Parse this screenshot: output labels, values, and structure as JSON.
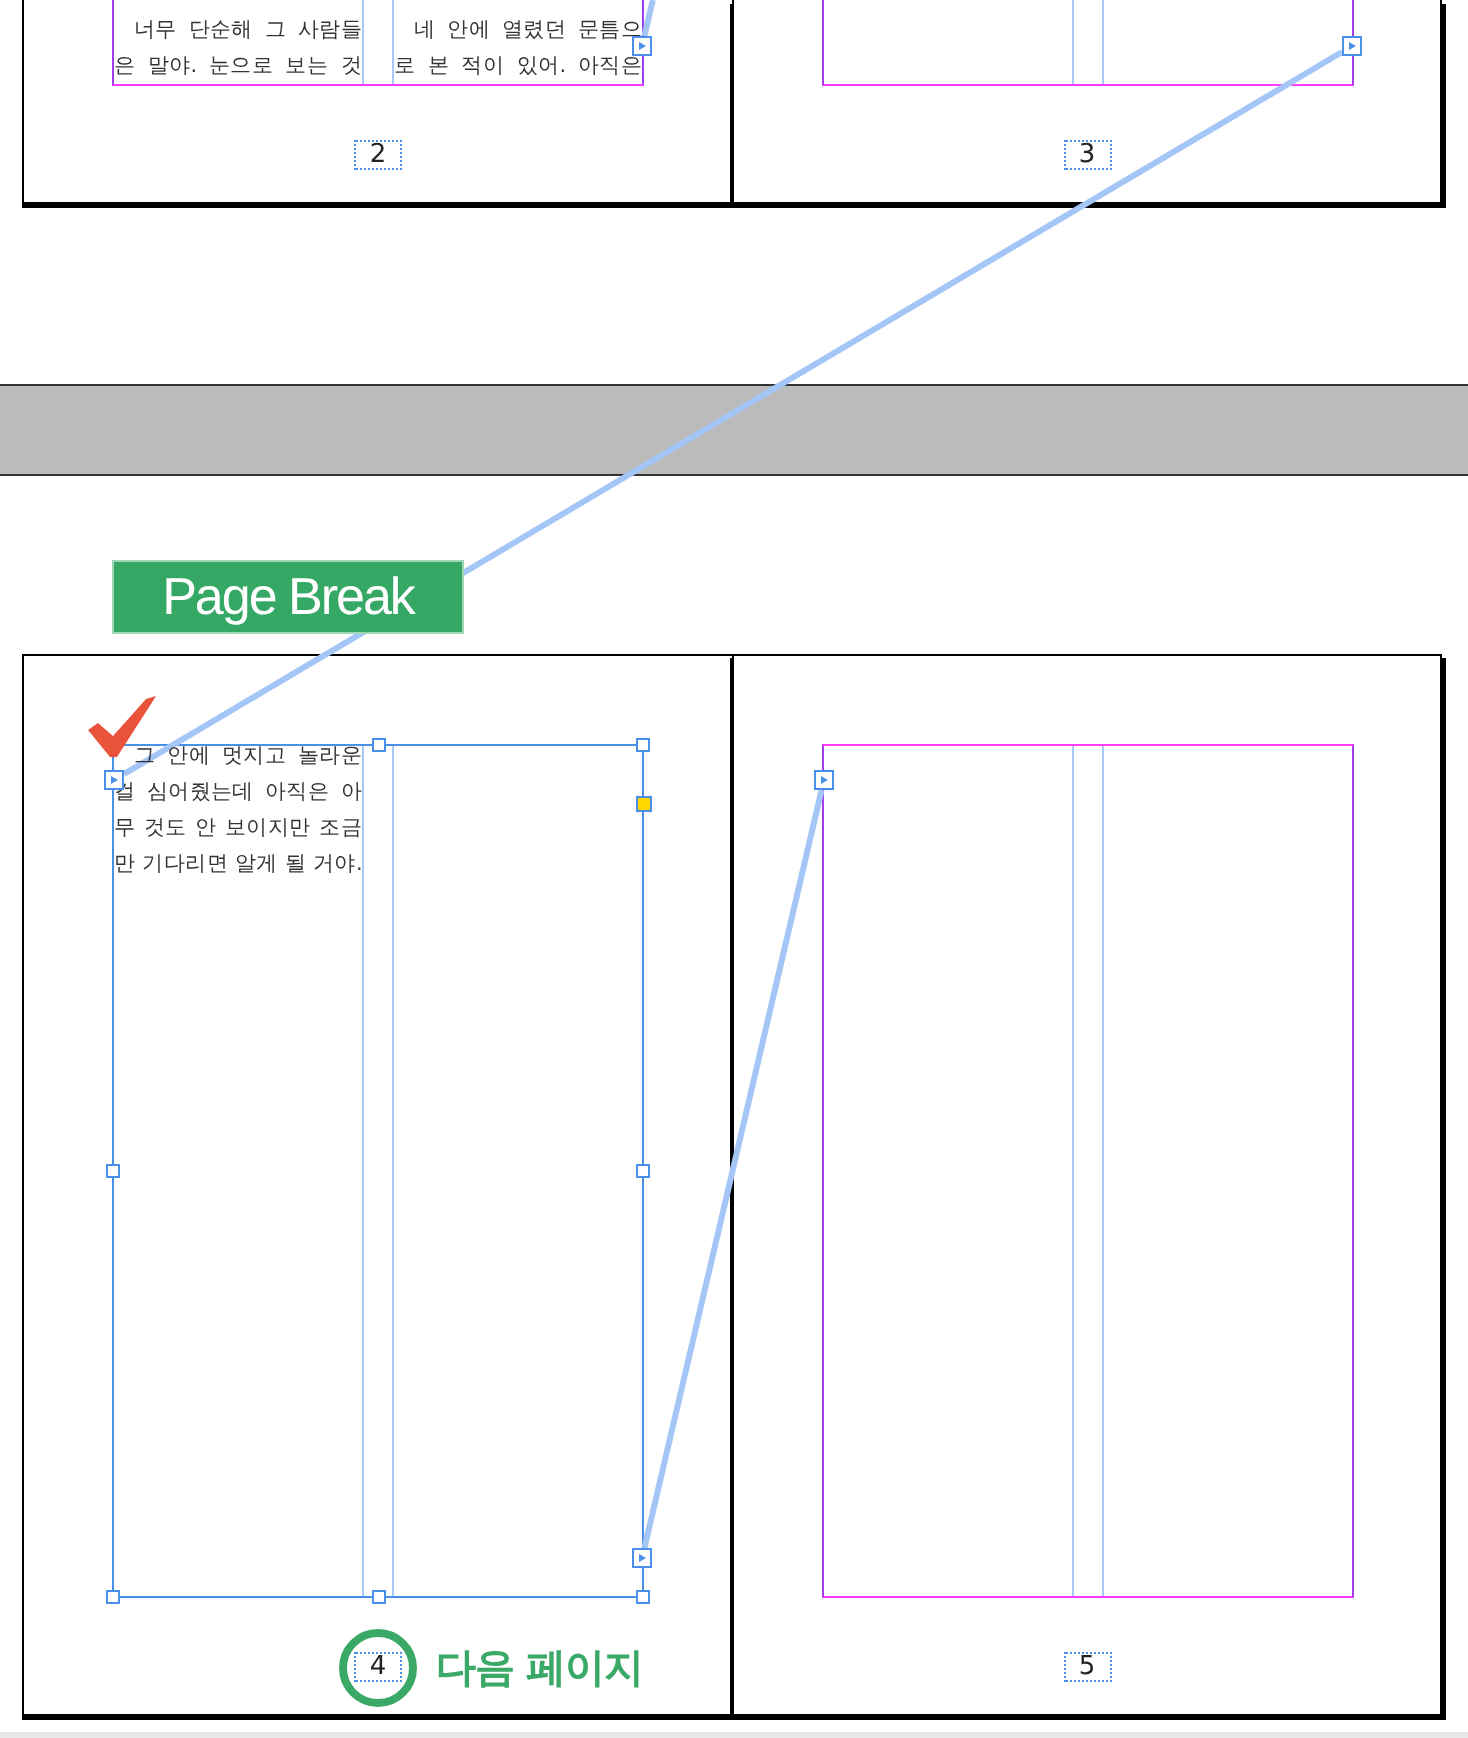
{
  "spreads": [
    {
      "pages": [
        {
          "page_number": {
            "text": "2",
            "circled": false
          },
          "check_mark": false,
          "text_frame": {
            "selected": false,
            "in_port": false,
            "out_port": true,
            "columns": [
              [
                {
                  "text": "너무 단순해 그 사람들",
                  "indent": true
                },
                {
                  "text": "은 말야. 눈으로 보는 것",
                  "indent": false
                }
              ],
              [
                {
                  "text": "네 안에 열렸던 문틈으",
                  "indent": true
                },
                {
                  "text": "로 본 적이 있어. 아직은",
                  "indent": false
                }
              ]
            ]
          }
        },
        {
          "page_number": {
            "text": "3",
            "circled": false
          },
          "check_mark": false,
          "text_frame": {
            "selected": false,
            "in_port": false,
            "out_port": true
          }
        }
      ]
    },
    {
      "break_label": "Page Break",
      "pages": [
        {
          "page_number": {
            "text": "4",
            "circled": true,
            "caption": "다음 페이지"
          },
          "check_mark": true,
          "text_frame": {
            "selected": true,
            "in_port": true,
            "out_port": true,
            "columns": [
              [
                {
                  "text": "그 안에 멋지고 놀라운",
                  "indent": true
                },
                {
                  "text": "걸 심어줬는데 아직은 아",
                  "indent": false
                },
                {
                  "text": "무 것도 안 보이지만 조금",
                  "indent": false
                },
                {
                  "text": "만 기다리면 알게 될 거야.",
                  "indent": false
                }
              ]
            ]
          }
        },
        {
          "page_number": {
            "text": "5",
            "circled": false
          },
          "check_mark": false,
          "text_frame": {
            "selected": false,
            "in_port": true,
            "out_port": false
          }
        }
      ]
    }
  ]
}
